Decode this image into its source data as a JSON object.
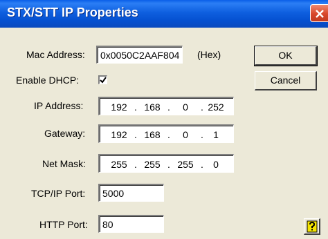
{
  "window": {
    "title": "STX/STT IP Properties"
  },
  "fields": {
    "mac_label": "Mac Address:",
    "mac_value": "0x0050C2AAF804",
    "mac_unit": "(Hex)",
    "dhcp_label": "Enable DHCP:",
    "dhcp_checked": true,
    "ip_label": "IP Address:",
    "ip": [
      "192",
      "168",
      "0",
      "252"
    ],
    "gateway_label": "Gateway:",
    "gateway": [
      "192",
      "168",
      "0",
      "1"
    ],
    "netmask_label": "Net Mask:",
    "netmask": [
      "255",
      "255",
      "255",
      "0"
    ],
    "tcp_label": "TCP/IP Port:",
    "tcp_value": "5000",
    "http_label": "HTTP Port:",
    "http_value": "80"
  },
  "buttons": {
    "ok": "OK",
    "cancel": "Cancel"
  },
  "icons": {
    "close": "close-icon",
    "help": "help-question-icon",
    "check": "checkmark-icon"
  },
  "colors": {
    "titlebar": "#0a5fe8",
    "close": "#d8462a",
    "background": "#ece9d8"
  }
}
